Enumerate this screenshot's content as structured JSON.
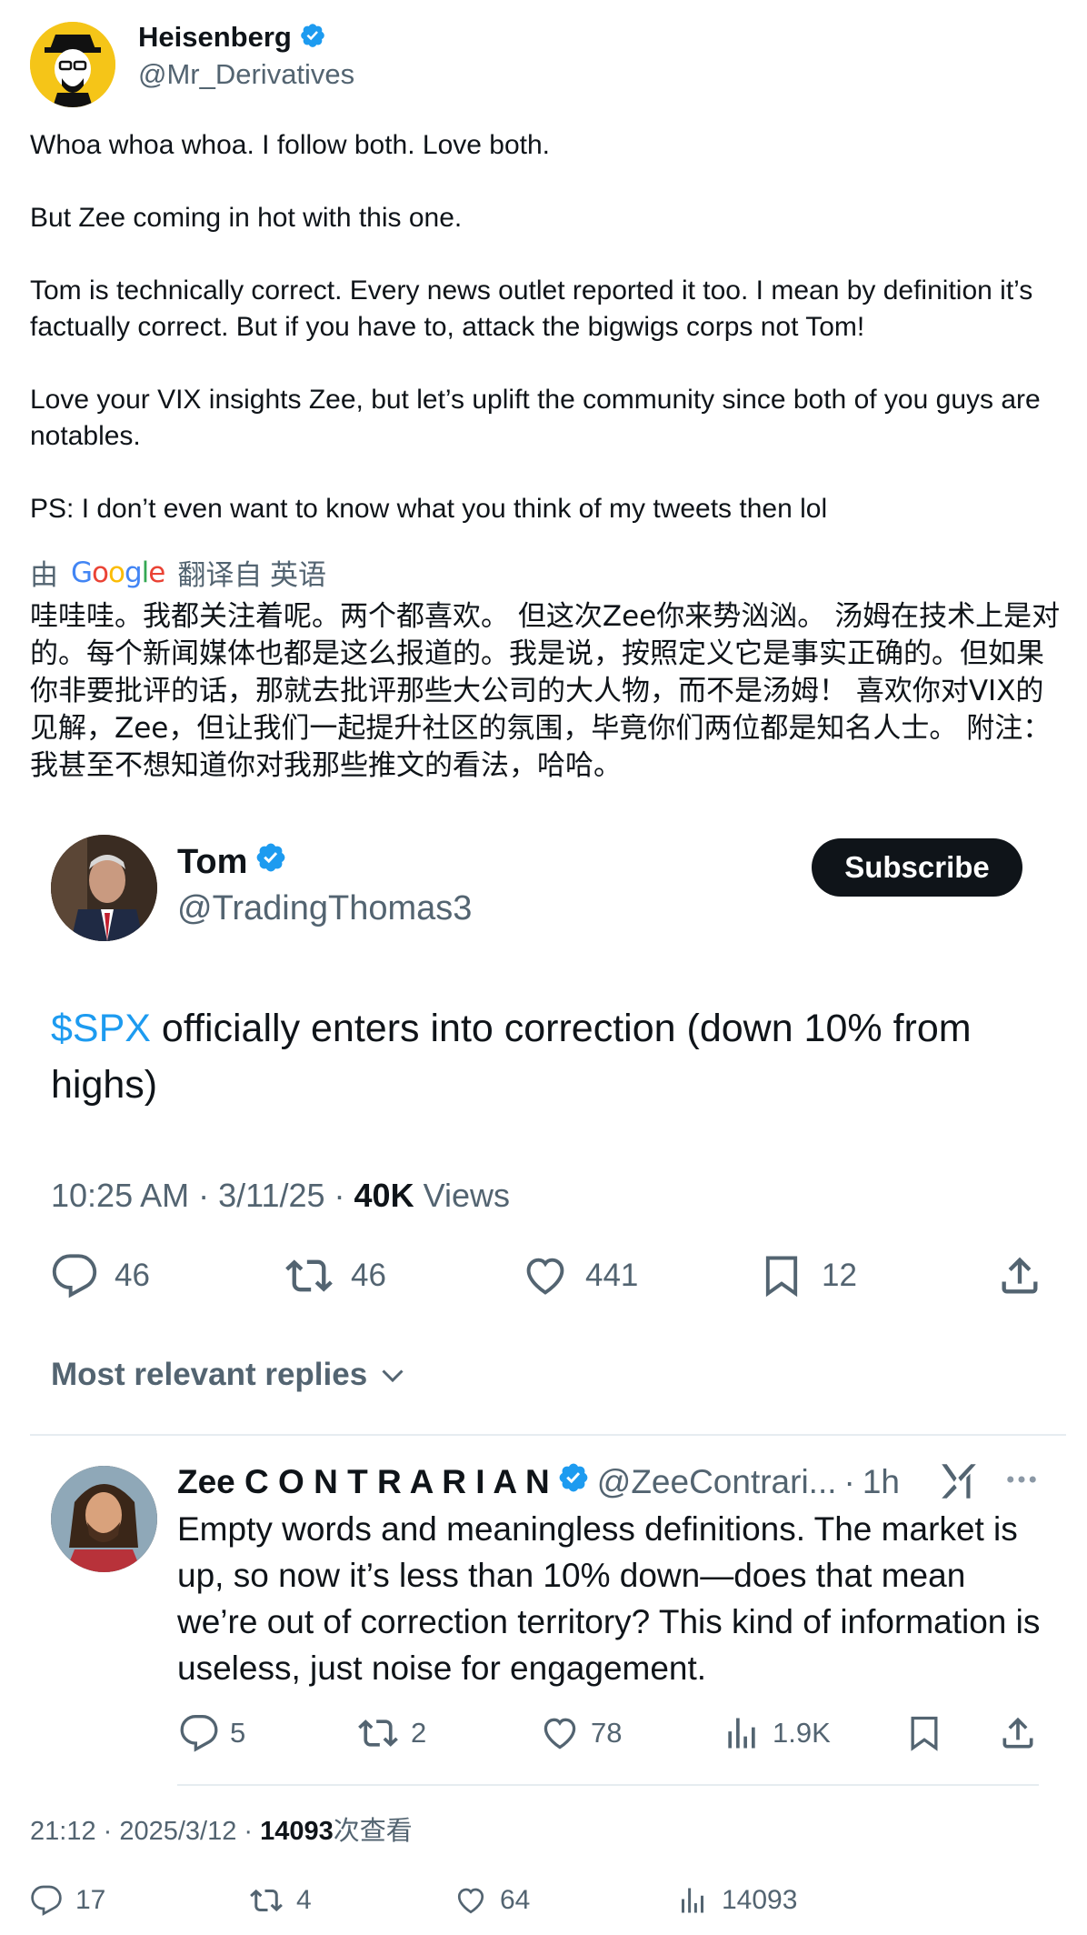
{
  "post": {
    "name": "Heisenberg",
    "handle": "@Mr_Derivatives",
    "paragraphs": [
      "Whoa whoa whoa. I follow both. Love both.",
      "But Zee coming in hot with this one.",
      "Tom is technically correct. Every news outlet reported it too. I mean by definition it’s factually correct. But if you have to, attack the bigwigs corps not Tom!",
      "Love your VIX insights Zee, but let’s uplift the community since both of you guys are notables.",
      "PS: I don’t even want to know what you think of my tweets then lol"
    ],
    "translate_prefix": "由",
    "translate_brand": "Google",
    "translate_suffix": "翻译自 英语",
    "translated_text": "哇哇哇。我都关注着呢。两个都喜欢。 但这次Zee你来势汹汹。 汤姆在技术上是对的。每个新闻媒体也都是这么报道的。我是说，按照定义它是事实正确的。但如果你非要批评的话，那就去批评那些大公司的大人物，而不是汤姆！ 喜欢你对VIX的见解，Zee，但让我们一起提升社区的氛围，毕竟你们两位都是知名人士。 附注：我甚至不想知道你对我那些推文的看法，哈哈。",
    "meta_time": "21:12 · 2025/3/12 · ",
    "meta_views": "14093",
    "meta_views_suffix": "次查看",
    "actions": {
      "replies": "17",
      "reposts": "4",
      "likes": "64",
      "views": "14093"
    }
  },
  "quoted": {
    "name": "Tom",
    "handle": "@TradingThomas3",
    "subscribe_label": "Subscribe",
    "cashtag": "$SPX",
    "text": " officially enters into correction (down 10% from highs)",
    "meta_time": "10:25 AM · 3/11/25 · ",
    "meta_views": "40K",
    "meta_views_suffix": " Views",
    "actions": {
      "replies": "46",
      "reposts": "46",
      "likes": "441",
      "bookmarks": "12"
    },
    "replies_filter_label": "Most relevant replies"
  },
  "reply": {
    "name": "Zee C O N T R A R I A N",
    "handle": "@ZeeContrari...",
    "separator": "·",
    "time": "1h",
    "text": "Empty words and meaningless definitions. The market is up, so now it’s less than 10% down—does that mean we’re out of correction territory? This kind of information is useless, just noise for engagement.",
    "actions": {
      "replies": "5",
      "reposts": "2",
      "likes": "78",
      "views": "1.9K"
    }
  },
  "colors": {
    "accent": "#1d9bf0",
    "text": "#0f1419",
    "muted": "#536471",
    "avatar_bg": "#f5c518"
  },
  "icons": [
    "verified-badge-icon",
    "reply-icon",
    "repost-icon",
    "like-icon",
    "bookmark-icon",
    "share-icon",
    "views-icon",
    "grok-icon",
    "more-icon",
    "chevron-down-icon"
  ]
}
